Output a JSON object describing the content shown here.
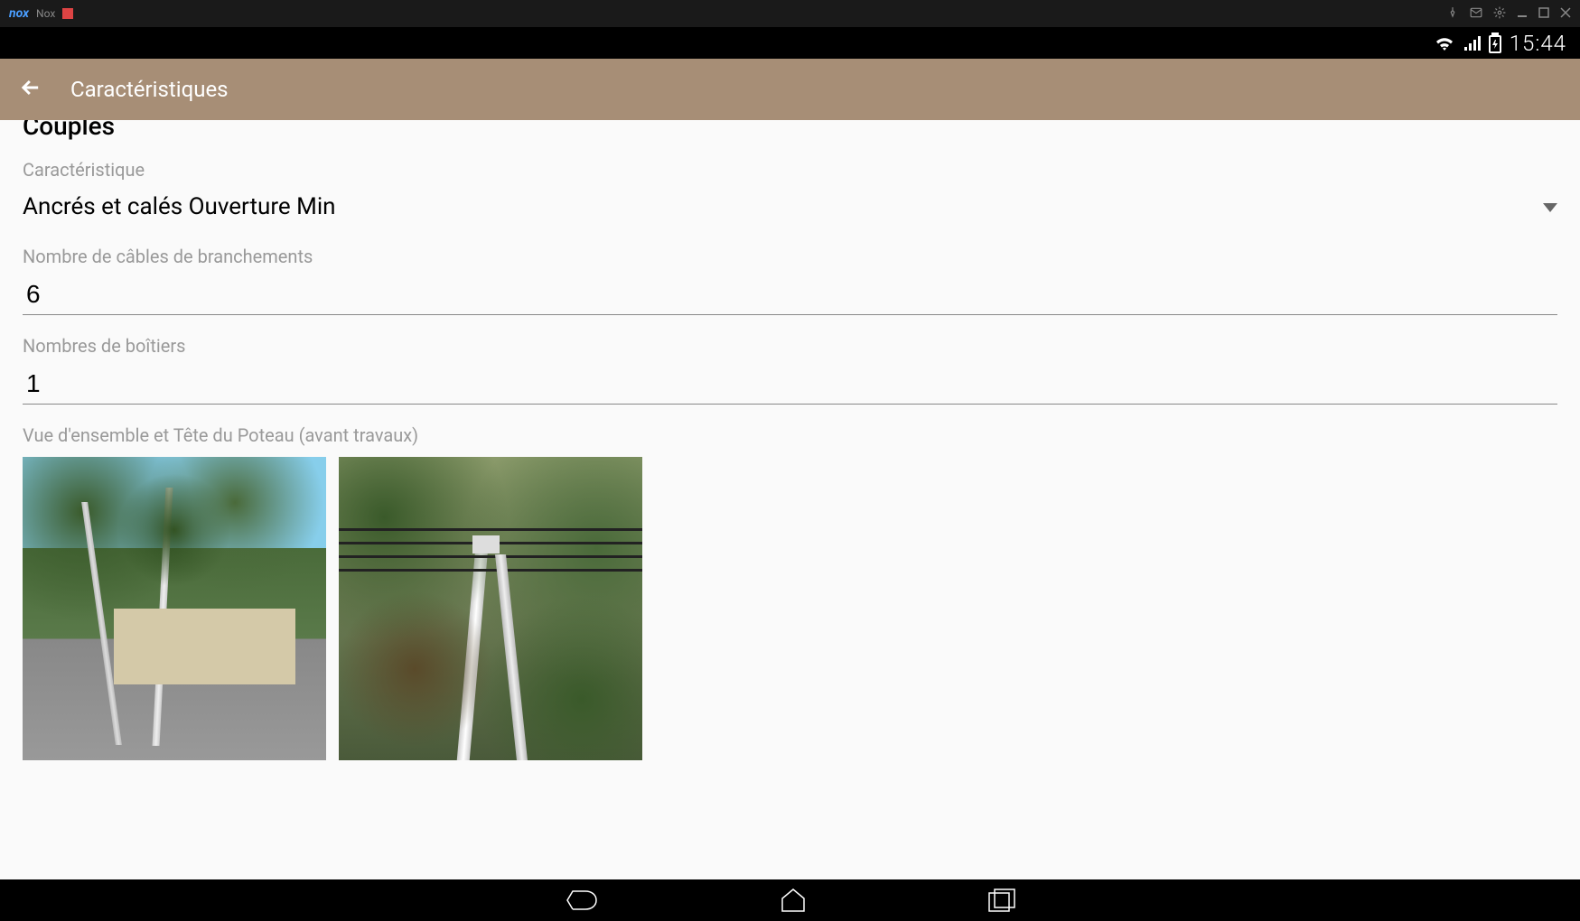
{
  "nox": {
    "logo": "nox",
    "title": "Nox"
  },
  "statusbar": {
    "time": "15:44"
  },
  "header": {
    "title": "Caractéristiques"
  },
  "form": {
    "section_title": "Couples",
    "caracteristique": {
      "label": "Caractéristique",
      "value": "Ancrés et calés Ouverture Min"
    },
    "cables": {
      "label": "Nombre de câbles de branchements",
      "value": "6"
    },
    "boitiers": {
      "label": "Nombres de boîtiers",
      "value": "1"
    },
    "photos": {
      "label": "Vue d'ensemble et Tête du Poteau (avant travaux)"
    }
  }
}
